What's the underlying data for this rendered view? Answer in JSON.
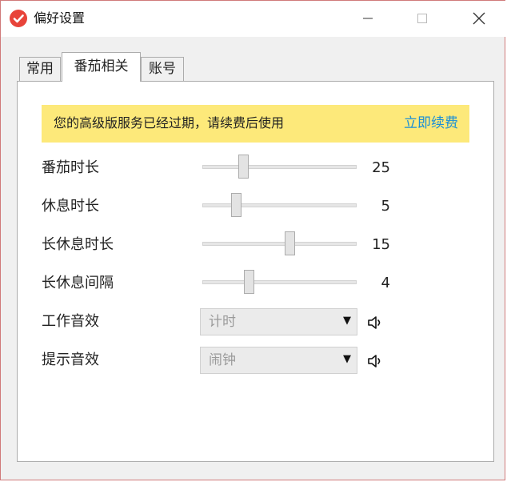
{
  "window": {
    "title": "偏好设置",
    "accent_color": "#e8443a"
  },
  "tabs": [
    {
      "label": "常用",
      "selected": false
    },
    {
      "label": "番茄相关",
      "selected": true
    },
    {
      "label": "账号",
      "selected": false
    }
  ],
  "notice": {
    "text": "您的高级版服务已经过期，请续费后使用",
    "link": "立即续费",
    "background": "#fde97a",
    "link_color": "#1a8fd6"
  },
  "sliders": [
    {
      "label": "番茄时长",
      "value": "25",
      "position": 0.25
    },
    {
      "label": "休息时长",
      "value": "5",
      "position": 0.2
    },
    {
      "label": "长休息时长",
      "value": "15",
      "position": 0.57
    },
    {
      "label": "长休息间隔",
      "value": "4",
      "position": 0.29
    }
  ],
  "sounds": [
    {
      "label": "工作音效",
      "value": "计时",
      "icon": "speaker-icon"
    },
    {
      "label": "提示音效",
      "value": "闹钟",
      "icon": "speaker-icon"
    }
  ]
}
